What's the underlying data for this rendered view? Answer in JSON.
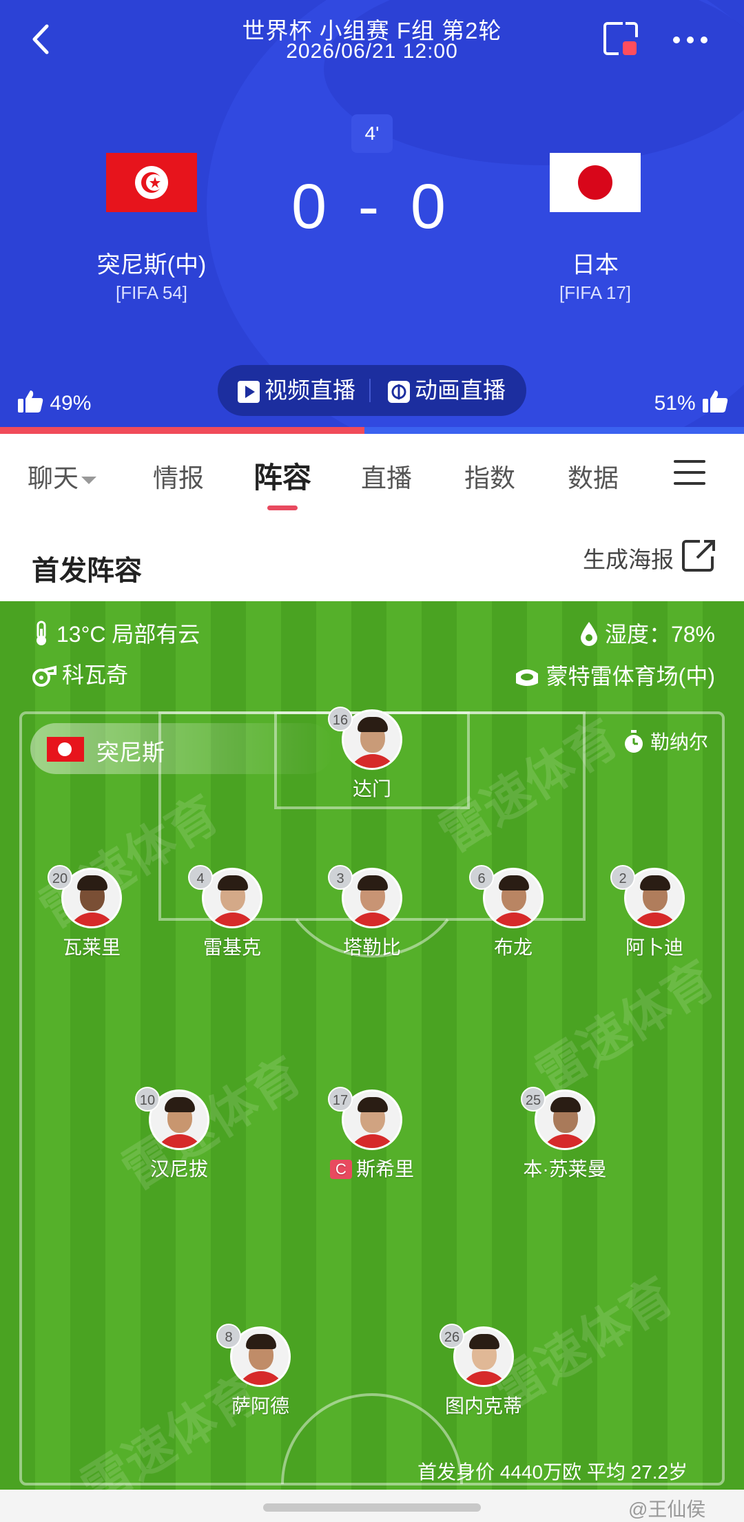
{
  "header": {
    "title": "世界杯 小组赛 F组 第2轮",
    "datetime": "2026/06/21 12:00",
    "minute": "4'",
    "home": {
      "name": "突尼斯(中)",
      "rank": "[FIFA 54]",
      "flag_colors": [
        "#e7141c",
        "#ffffff"
      ]
    },
    "away": {
      "name": "日本",
      "rank": "[FIFA 17]",
      "flag_colors": [
        "#ffffff",
        "#d8061a"
      ]
    },
    "score": "0 - 0",
    "video_live_label": "视频直播",
    "animation_live_label": "动画直播",
    "home_vote": "49%",
    "away_vote": "51%",
    "home_vote_fraction": 0.49,
    "colors": {
      "header_bg": "#2c42d6",
      "home_vote": "#f04b5a",
      "away_vote": "#3b62f0"
    }
  },
  "tabs": [
    {
      "label": "聊天"
    },
    {
      "label": "情报"
    },
    {
      "label": "阵容",
      "active": true
    },
    {
      "label": "直播"
    },
    {
      "label": "指数"
    },
    {
      "label": "数据"
    }
  ],
  "section": {
    "title": "首发阵容",
    "poster_label": "生成海报"
  },
  "match_conditions": {
    "temperature": "13°C 局部有云",
    "humidity": "湿度：78%",
    "referee": "科瓦奇",
    "venue": "蒙特雷体育场(中)"
  },
  "team_chip": {
    "name": "突尼斯"
  },
  "coach": {
    "name": "勒纳尔"
  },
  "players": [
    {
      "number": "16",
      "name": "达门",
      "line": "goalkeeper"
    },
    {
      "number": "20",
      "name": "瓦莱里",
      "line": "defense"
    },
    {
      "number": "4",
      "name": "雷基克",
      "line": "defense"
    },
    {
      "number": "3",
      "name": "塔勒比",
      "line": "defense"
    },
    {
      "number": "6",
      "name": "布龙",
      "line": "defense"
    },
    {
      "number": "2",
      "name": "阿卜迪",
      "line": "defense"
    },
    {
      "number": "10",
      "name": "汉尼拔",
      "line": "midfield"
    },
    {
      "number": "17",
      "name": "斯希里",
      "line": "midfield",
      "captain": true
    },
    {
      "number": "25",
      "name": "本·苏莱曼",
      "line": "midfield"
    },
    {
      "number": "8",
      "name": "萨阿德",
      "line": "attack"
    },
    {
      "number": "26",
      "name": "图内克蒂",
      "line": "attack"
    }
  ],
  "captain_badge": "C",
  "summary": "首发身价 4440万欧  平均 27.2岁",
  "watermark": "雷速体育",
  "weibo_mark": "@王仙侯",
  "icons": [
    "back-icon",
    "screen-record-icon",
    "more-icon",
    "play-icon",
    "animation-icon",
    "thumbs-up-icon",
    "menu-icon",
    "share-icon",
    "thermometer-icon",
    "whistle-icon",
    "water-drop-icon",
    "stadium-icon",
    "stopwatch-icon"
  ]
}
